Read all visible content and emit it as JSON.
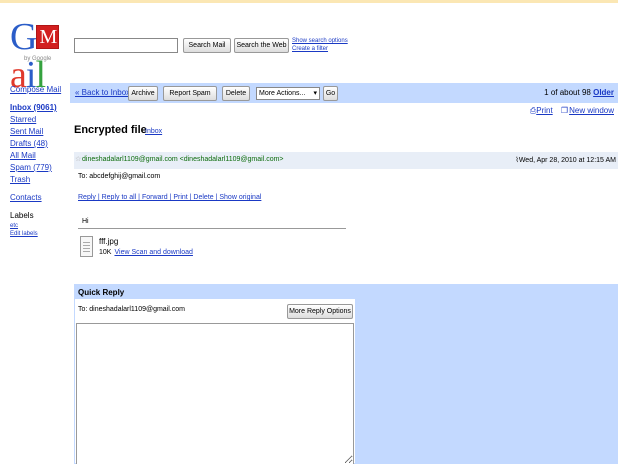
{
  "header": {
    "logo_text": "Gmail",
    "logo_sub": "by Google",
    "search_mail_label": "Search Mail",
    "search_web_label": "Search the Web",
    "show_search_options": "Show search options",
    "create_filter": "Create a filter"
  },
  "sidebar": {
    "compose": "Compose Mail",
    "items": [
      {
        "label": "Inbox (9061)"
      },
      {
        "label": "Starred"
      },
      {
        "label": "Sent Mail"
      },
      {
        "label": "Drafts (48)"
      },
      {
        "label": "All Mail"
      },
      {
        "label": "Spam (779)"
      },
      {
        "label": "Trash"
      }
    ],
    "contacts": "Contacts",
    "labels_heading": "Labels",
    "labels": [
      "etc",
      "Edit labels"
    ]
  },
  "toolbar": {
    "back": "« Back to Inbox",
    "archive": "Archive",
    "report_spam": "Report Spam",
    "delete": "Delete",
    "more_actions": "More Actions...",
    "go": "Go",
    "count": "1 of about 98",
    "older": "Older"
  },
  "actions": {
    "print": "Print",
    "new_window": "New window"
  },
  "message": {
    "subject": "Encrypted file",
    "label_tag": "Inbox",
    "from": "dineshadalarl1109@gmail.com <dineshadalarl1109@gmail.com>",
    "date": "Wed, Apr 28, 2010 at 12:15 AM",
    "to": "To: abcdefghij@gmail.com",
    "links": "Reply | Reply to all | Forward | Print | Delete | Show original",
    "greeting": "Hi",
    "attachment_name": "fff.jpg",
    "attachment_size": "10K",
    "attachment_link": "View Scan and download"
  },
  "quick_reply": {
    "title": "Quick Reply",
    "to": "To: dineshadalarl1109@gmail.com",
    "more_options": "More Reply Options"
  },
  "colors": {
    "blue_bar": "#c3d9ff",
    "link": "#1a39c4"
  }
}
